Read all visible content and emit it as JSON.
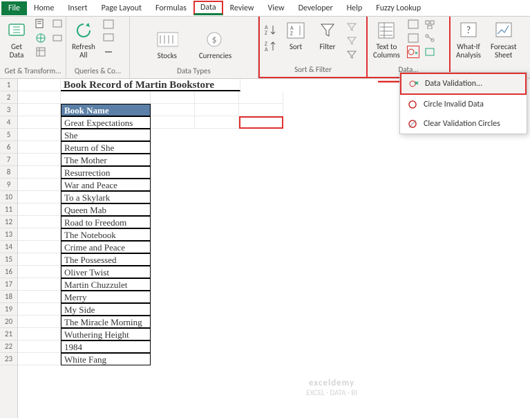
{
  "menu": {
    "file": "File",
    "home": "Home",
    "insert": "Insert",
    "page_layout": "Page Layout",
    "formulas": "Formulas",
    "data": "Data",
    "review": "Review",
    "view": "View",
    "developer": "Developer",
    "help": "Help",
    "fuzzy": "Fuzzy Lookup"
  },
  "ribbon": {
    "get_data": "Get\nData",
    "get_transform": "Get & Transform...",
    "refresh_all": "Refresh\nAll",
    "queries_conn": "Queries & Co...",
    "stocks": "Stocks",
    "currencies": "Currencies",
    "data_types": "Data Types",
    "sort": "Sort",
    "filter": "Filter",
    "sort_filter": "Sort & Filter",
    "text_to_columns": "Text to\nColumns",
    "data_tools": "Data...",
    "whatif": "What-If\nAnalysis",
    "forecast": "Forecast\nSheet"
  },
  "dropdown": {
    "validation": "Data Validation...",
    "circle": "Circle Invalid Data",
    "clear_circles": "Clear Validation Circles"
  },
  "sheet": {
    "title": "Book Record of Martin Bookstore",
    "header": "Book Name",
    "books": [
      "Great Expectations",
      "She",
      "Return of She",
      "The Mother",
      "Resurrection",
      "War and Peace",
      "To a Skylark",
      "Queen Mab",
      "Road to Freedom",
      "The Notebook",
      "Crime and Peace",
      "The Possessed",
      "Oliver Twist",
      "Martin Chuzzulet",
      "Merry",
      "My Side",
      "The Miracle Morning",
      "Wuthering Height",
      "1984",
      "White Fang"
    ]
  },
  "watermark": {
    "brand": "exceldemy",
    "sub": "EXCEL · DATA · BI"
  }
}
